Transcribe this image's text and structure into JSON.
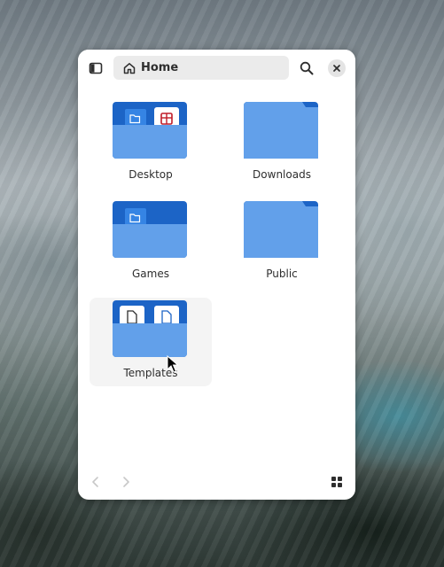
{
  "window": {
    "location": "Home",
    "accent_color": "#3584e4",
    "folder_back_color": "#1c64c6",
    "folder_front_color": "#62a0ea"
  },
  "items": [
    {
      "label": "Desktop",
      "emblems": [
        "folder-emblem-icon",
        "calendar-emblem-icon"
      ]
    },
    {
      "label": "Downloads",
      "emblems": []
    },
    {
      "label": "Games",
      "emblems": [
        "folder-emblem-icon"
      ]
    },
    {
      "label": "Public",
      "emblems": []
    },
    {
      "label": "Templates",
      "emblems": [
        "document-emblem-icon",
        "document-emblem-icon"
      ],
      "selected": true
    }
  ],
  "icons": {
    "sidebar_toggle": "sidebar-icon",
    "location": "home-icon",
    "search": "search-icon",
    "close": "close-icon",
    "back": "chevron-left-icon",
    "forward": "chevron-right-icon",
    "view": "grid-view-icon"
  }
}
